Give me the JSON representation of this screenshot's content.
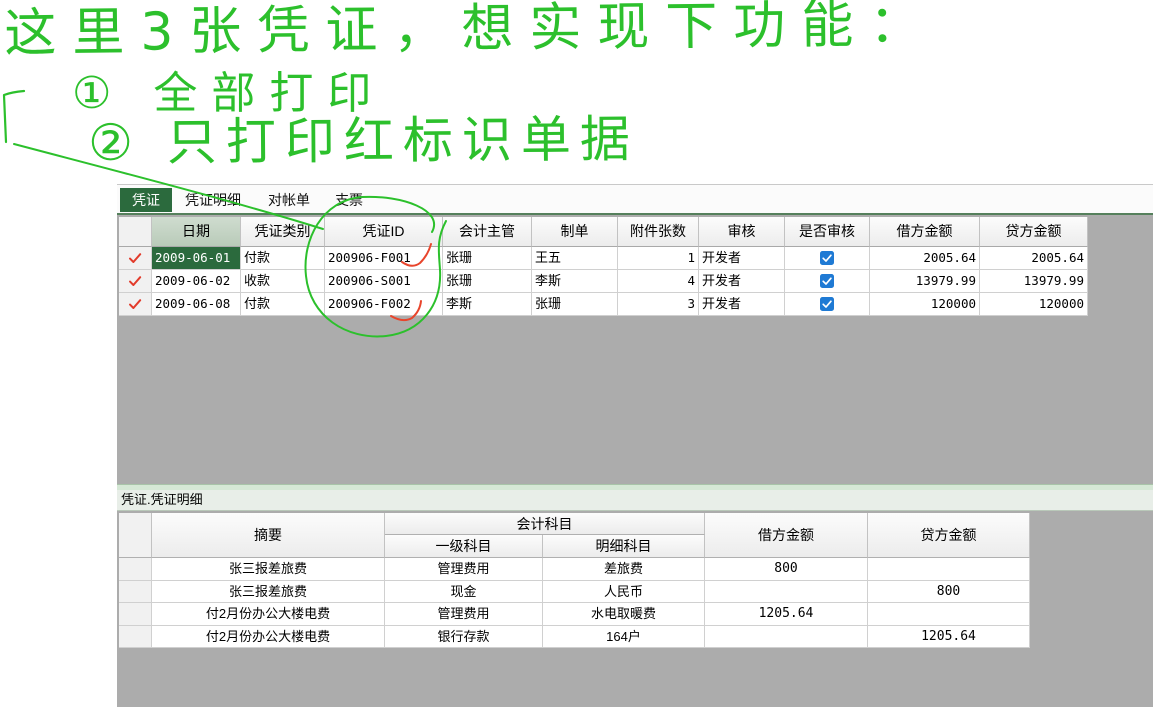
{
  "annotation": {
    "line1": "这里3张凭证，想实现下功能：",
    "line2": "① 全部打印",
    "line3": "② 只打印红标识单据"
  },
  "colors": {
    "annotation_green": "#2cc02c",
    "annotation_red": "#e8452c",
    "accent": "#2b6a3d",
    "row_marker": "#e23b2b",
    "checkbox": "#1f7ad4",
    "workspace": "#acacac"
  },
  "tabs": [
    {
      "label": "凭证",
      "active": true
    },
    {
      "label": "凭证明细",
      "active": false
    },
    {
      "label": "对帐单",
      "active": false
    },
    {
      "label": "支票",
      "active": false
    }
  ],
  "voucher_grid": {
    "row_marker_icon": "check-mark-icon",
    "current_cell": {
      "row": 0,
      "column": 0
    },
    "columns": [
      "日期",
      "凭证类别",
      "凭证ID",
      "会计主管",
      "制单",
      "附件张数",
      "审核",
      "是否审核",
      "借方金额",
      "贷方金额"
    ],
    "rows": [
      {
        "marked": true,
        "date": "2009-06-01",
        "type": "付款",
        "voucher_id": "200906-F001",
        "supervisor": "张珊",
        "maker": "王五",
        "attachments": "1",
        "auditor": "开发者",
        "audited": true,
        "debit": "2005.64",
        "credit": "2005.64"
      },
      {
        "marked": true,
        "date": "2009-06-02",
        "type": "收款",
        "voucher_id": "200906-S001",
        "supervisor": "张珊",
        "maker": "李斯",
        "attachments": "4",
        "auditor": "开发者",
        "audited": true,
        "debit": "13979.99",
        "credit": "13979.99"
      },
      {
        "marked": true,
        "date": "2009-06-08",
        "type": "付款",
        "voucher_id": "200906-F002",
        "supervisor": "李斯",
        "maker": "张珊",
        "attachments": "3",
        "auditor": "开发者",
        "audited": true,
        "debit": "120000",
        "credit": "120000"
      }
    ]
  },
  "detail_grid": {
    "title": "凭证.凭证明细",
    "headers": {
      "summary": "摘要",
      "account_group": "会计科目",
      "level1": "一级科目",
      "detail": "明细科目",
      "debit": "借方金额",
      "credit": "贷方金额"
    },
    "rows": [
      {
        "summary": "张三报差旅费",
        "level1": "管理费用",
        "detail": "差旅费",
        "debit": "800",
        "credit": ""
      },
      {
        "summary": "张三报差旅费",
        "level1": "现金",
        "detail": "人民币",
        "debit": "",
        "credit": "800"
      },
      {
        "summary": "付2月份办公大楼电费",
        "level1": "管理费用",
        "detail": "水电取暖费",
        "debit": "1205.64",
        "credit": ""
      },
      {
        "summary": "付2月份办公大楼电费",
        "level1": "银行存款",
        "detail": "164户",
        "debit": "",
        "credit": "1205.64"
      }
    ]
  }
}
